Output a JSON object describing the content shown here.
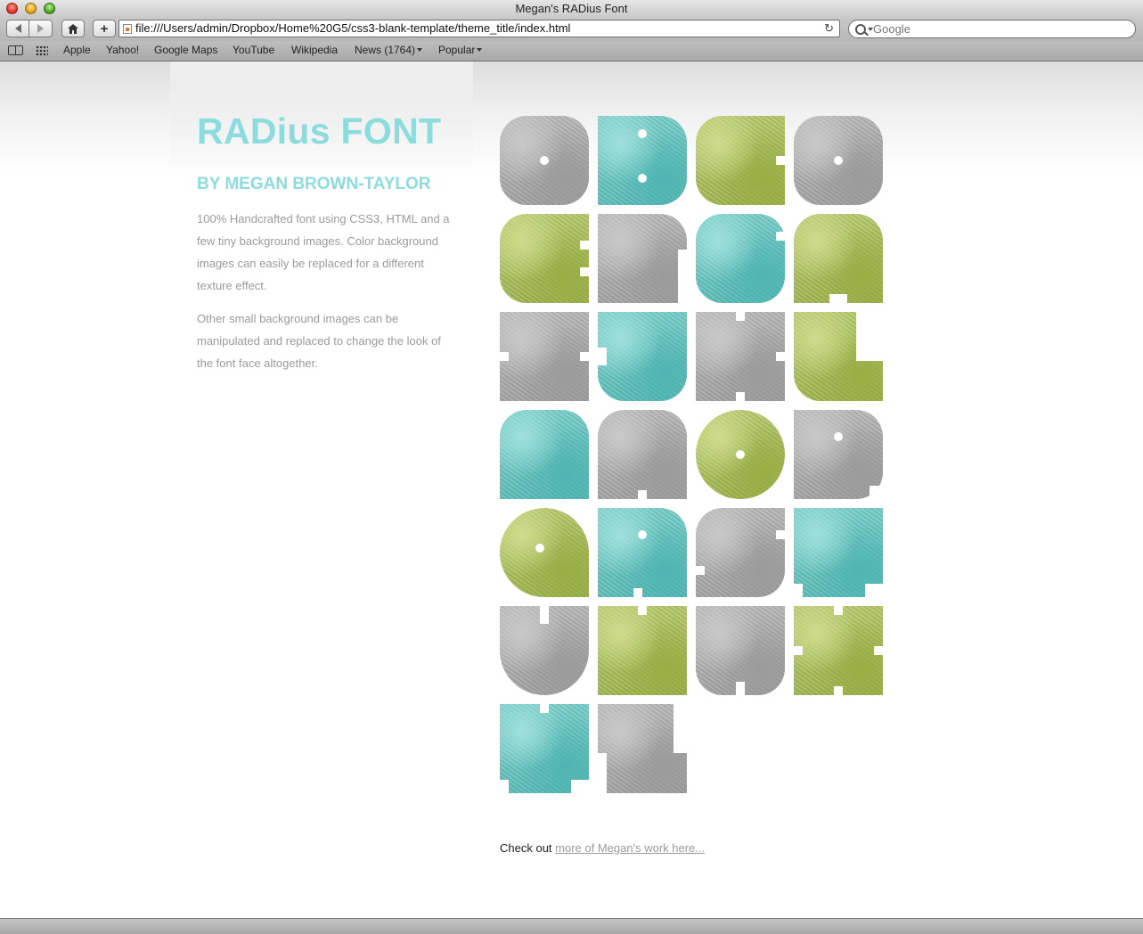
{
  "window": {
    "title": "Megan's RADius Font"
  },
  "toolbar": {
    "url": "file:///Users/admin/Dropbox/Home%20G5/css3-blank-template/theme_title/index.html",
    "search_placeholder": "Google",
    "add_label": "+"
  },
  "bookmarks": [
    {
      "label": "Apple",
      "menu": false
    },
    {
      "label": "Yahoo!",
      "menu": false
    },
    {
      "label": "Google Maps",
      "menu": false
    },
    {
      "label": "YouTube",
      "menu": false
    },
    {
      "label": "Wikipedia",
      "menu": false
    },
    {
      "label": "News (1764)",
      "menu": true
    },
    {
      "label": "Popular",
      "menu": true
    }
  ],
  "page": {
    "title": "RADius FONT",
    "byline": "BY MEGAN BROWN-TAYLOR",
    "paragraphs": [
      "100% Handcrafted font using CSS3, HTML and a few tiny background images. Color background images can easily be replaced for a different texture effect.",
      "Other small background images can be manipulated and replaced to change the look of the font face altogether."
    ],
    "letters": [
      {
        "letter": "a",
        "color": "gray"
      },
      {
        "letter": "b",
        "color": "teal"
      },
      {
        "letter": "c",
        "color": "green"
      },
      {
        "letter": "d",
        "color": "gray"
      },
      {
        "letter": "e",
        "color": "green"
      },
      {
        "letter": "f",
        "color": "gray"
      },
      {
        "letter": "g",
        "color": "teal"
      },
      {
        "letter": "h",
        "color": "green"
      },
      {
        "letter": "i",
        "color": "gray"
      },
      {
        "letter": "j",
        "color": "teal"
      },
      {
        "letter": "k",
        "color": "gray"
      },
      {
        "letter": "l",
        "color": "green"
      },
      {
        "letter": "m",
        "color": "teal"
      },
      {
        "letter": "n",
        "color": "gray"
      },
      {
        "letter": "o",
        "color": "green"
      },
      {
        "letter": "p",
        "color": "gray"
      },
      {
        "letter": "q",
        "color": "green"
      },
      {
        "letter": "r",
        "color": "teal"
      },
      {
        "letter": "s",
        "color": "gray"
      },
      {
        "letter": "t",
        "color": "teal"
      },
      {
        "letter": "u",
        "color": "gray"
      },
      {
        "letter": "v",
        "color": "green"
      },
      {
        "letter": "w",
        "color": "gray"
      },
      {
        "letter": "x",
        "color": "green"
      },
      {
        "letter": "y",
        "color": "teal"
      },
      {
        "letter": "z",
        "color": "gray"
      }
    ],
    "footer_prefix": "Check out",
    "footer_link": "more of Megan's work here..."
  },
  "colors": {
    "accent": "#8ddcdd",
    "gray": "#a8a8a8",
    "teal": "#6cc8c6",
    "green": "#b3c664",
    "body_text": "#9a9a9a"
  }
}
